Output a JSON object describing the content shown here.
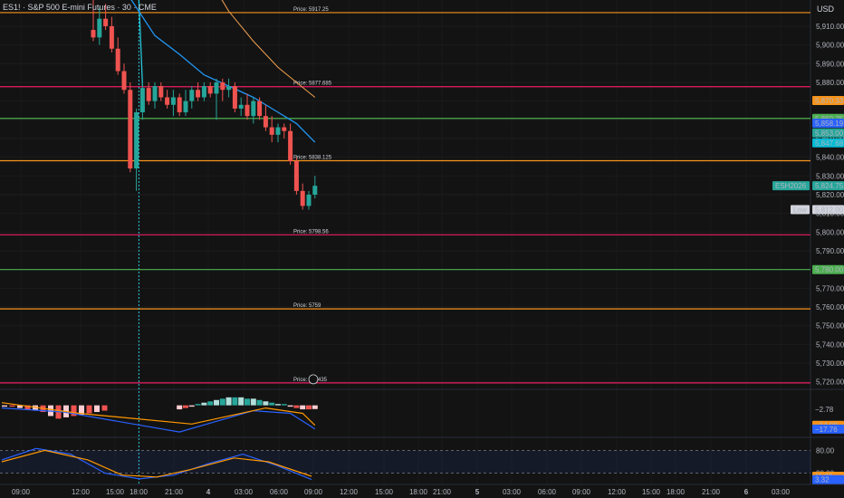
{
  "header": {
    "symbol_title": "ES1! · S&P 500 E-mini Futures · 30 · CME",
    "currency": "USD"
  },
  "colors": {
    "background": "#131313",
    "up": "#26a69a",
    "down": "#ef5350",
    "level_orange": "#f7931a",
    "level_pink": "#e91e63",
    "level_green": "#4caf50",
    "ma_blue": "#2962ff",
    "ma_orange": "#f0a050",
    "crosshair": "#26c6da"
  },
  "chart_data": [
    {
      "type": "candlestick",
      "y_ticks": [
        5910,
        5900,
        5890,
        5880,
        5870,
        5860,
        5850,
        5840,
        5830,
        5820,
        5810,
        5800,
        5790,
        5780,
        5770,
        5760,
        5750,
        5740,
        5730,
        5720
      ],
      "x_ticks": [
        "09:00",
        "12:00",
        "15:00",
        "18:00",
        "21:00",
        "4",
        "03:00",
        "06:00",
        "09:00",
        "12:00",
        "15:00",
        "18:00",
        "21:00",
        "5",
        "03:00",
        "06:00",
        "09:00",
        "12:00",
        "15:00",
        "18:00",
        "21:00",
        "6",
        "03:00"
      ],
      "ylim": [
        5716,
        5924
      ],
      "candles": [
        {
          "o": 5908,
          "h": 5924,
          "l": 5902,
          "c": 5904
        },
        {
          "o": 5904,
          "h": 5920,
          "l": 5900,
          "c": 5914
        },
        {
          "o": 5914,
          "h": 5922,
          "l": 5908,
          "c": 5910
        },
        {
          "o": 5910,
          "h": 5915,
          "l": 5896,
          "c": 5898
        },
        {
          "o": 5898,
          "h": 5904,
          "l": 5884,
          "c": 5886
        },
        {
          "o": 5886,
          "h": 5890,
          "l": 5874,
          "c": 5876
        },
        {
          "o": 5876,
          "h": 5880,
          "l": 5832,
          "c": 5834
        },
        {
          "o": 5834,
          "h": 5866,
          "l": 5822,
          "c": 5864
        },
        {
          "o": 5864,
          "h": 5880,
          "l": 5860,
          "c": 5877
        },
        {
          "o": 5877,
          "h": 5880,
          "l": 5868,
          "c": 5870
        },
        {
          "o": 5870,
          "h": 5880,
          "l": 5866,
          "c": 5878
        },
        {
          "o": 5878,
          "h": 5880,
          "l": 5870,
          "c": 5872
        },
        {
          "o": 5872,
          "h": 5876,
          "l": 5866,
          "c": 5868
        },
        {
          "o": 5868,
          "h": 5876,
          "l": 5862,
          "c": 5872
        },
        {
          "o": 5872,
          "h": 5874,
          "l": 5862,
          "c": 5864
        },
        {
          "o": 5864,
          "h": 5876,
          "l": 5862,
          "c": 5870
        },
        {
          "o": 5870,
          "h": 5878,
          "l": 5866,
          "c": 5876
        },
        {
          "o": 5876,
          "h": 5880,
          "l": 5870,
          "c": 5872
        },
        {
          "o": 5872,
          "h": 5880,
          "l": 5870,
          "c": 5878
        },
        {
          "o": 5878,
          "h": 5880,
          "l": 5872,
          "c": 5874
        },
        {
          "o": 5874,
          "h": 5882,
          "l": 5860,
          "c": 5880
        },
        {
          "o": 5880,
          "h": 5882,
          "l": 5870,
          "c": 5876
        },
        {
          "o": 5876,
          "h": 5882,
          "l": 5872,
          "c": 5878
        },
        {
          "o": 5878,
          "h": 5880,
          "l": 5864,
          "c": 5866
        },
        {
          "o": 5866,
          "h": 5872,
          "l": 5862,
          "c": 5868
        },
        {
          "o": 5868,
          "h": 5874,
          "l": 5860,
          "c": 5862
        },
        {
          "o": 5862,
          "h": 5872,
          "l": 5858,
          "c": 5870
        },
        {
          "o": 5870,
          "h": 5872,
          "l": 5860,
          "c": 5862
        },
        {
          "o": 5862,
          "h": 5868,
          "l": 5854,
          "c": 5856
        },
        {
          "o": 5856,
          "h": 5862,
          "l": 5848,
          "c": 5852
        },
        {
          "o": 5852,
          "h": 5858,
          "l": 5848,
          "c": 5856
        },
        {
          "o": 5856,
          "h": 5858,
          "l": 5850,
          "c": 5854
        },
        {
          "o": 5854,
          "h": 5858,
          "l": 5836,
          "c": 5838
        },
        {
          "o": 5838,
          "h": 5840,
          "l": 5820,
          "c": 5822
        },
        {
          "o": 5822,
          "h": 5826,
          "l": 5812,
          "c": 5814
        },
        {
          "o": 5814,
          "h": 5822,
          "l": 5812,
          "c": 5820
        },
        {
          "o": 5820,
          "h": 5830,
          "l": 5818,
          "c": 5824.75
        }
      ],
      "ma_fast": [
        [
          0,
          5940
        ],
        [
          5,
          5930
        ],
        [
          10,
          5905
        ],
        [
          14,
          5895
        ],
        [
          18,
          5884
        ],
        [
          22,
          5878
        ],
        [
          26,
          5872
        ],
        [
          30,
          5864
        ],
        [
          33,
          5858
        ],
        [
          36,
          5848
        ]
      ],
      "ma_slow": [
        [
          18,
          5940
        ],
        [
          22,
          5918
        ],
        [
          26,
          5902
        ],
        [
          30,
          5888
        ],
        [
          33,
          5880
        ],
        [
          36,
          5872
        ]
      ],
      "crosshair_index": 8,
      "levels": [
        {
          "price": 5917.25,
          "label": "Price: 5917.25",
          "color": "#f7931a"
        },
        {
          "price": 5877.685,
          "label": "Price: 5877.685",
          "color": "#e91e63"
        },
        {
          "price": 5860.75,
          "label": "",
          "color": "#4caf50"
        },
        {
          "price": 5838.125,
          "label": "Price: 5838.125",
          "color": "#f7931a"
        },
        {
          "price": 5798.56,
          "label": "Price: 5798.56",
          "color": "#e91e63"
        },
        {
          "price": 5780.0,
          "label": "",
          "color": "#4caf50"
        },
        {
          "price": 5759,
          "label": "Price: 5759",
          "color": "#f7931a"
        },
        {
          "price": 5719.435,
          "label": "Price: 57   .435",
          "color": "#e91e63"
        }
      ],
      "price_tags": [
        {
          "price": 5870.33,
          "text": "5,870.33",
          "bg": "#f7931a",
          "fg": "#131313"
        },
        {
          "price": 5860.75,
          "text": "5,860.75",
          "bg": "#4caf50",
          "fg": "#131313"
        },
        {
          "price": 5858.19,
          "text": "5,858.19",
          "bg": "#2962ff",
          "fg": "#ffffff"
        },
        {
          "price": 5853.0,
          "text": "5,853.00",
          "bg": "#26a69a",
          "fg": "#131313"
        },
        {
          "price": 5847.68,
          "text": "5,847.68",
          "bg": "#00bcd4",
          "fg": "#131313"
        },
        {
          "price": 5824.75,
          "text": "5,824.75",
          "bg": "#26a69a",
          "fg": "#ffffff"
        },
        {
          "price": 5812.0,
          "text": "5,812.00",
          "bg": "#d1d4dc",
          "fg": "#131313"
        },
        {
          "price": 5780.0,
          "text": "5,780.00",
          "bg": "#4caf50",
          "fg": "#131313"
        }
      ],
      "side_labels": [
        {
          "price": 5824.75,
          "text": "ESH2026",
          "bg": "#26a69a",
          "fg": "#ffffff"
        },
        {
          "price": 5812.0,
          "text": "Low",
          "bg": "#d1d4dc",
          "fg": "#131313"
        }
      ]
    },
    {
      "type": "bar",
      "panel": "macd",
      "histogram": [
        -1,
        -1,
        -2,
        -3,
        -4,
        -5,
        -8,
        -10,
        -9,
        -8,
        -7,
        -6,
        -5,
        -4,
        -3,
        -2,
        -1,
        1,
        2,
        3,
        4,
        5,
        6,
        6,
        6,
        5,
        5,
        4,
        3,
        2,
        1,
        1,
        -1,
        -2,
        -3,
        -3,
        -2.78
      ],
      "macd_line": [
        [
          0,
          -2
        ],
        [
          8,
          -5
        ],
        [
          14,
          -20
        ],
        [
          20,
          -12
        ],
        [
          26,
          -4
        ],
        [
          32,
          -6
        ],
        [
          36,
          -17.76
        ]
      ],
      "signal_line": [
        [
          0,
          2
        ],
        [
          10,
          -6
        ],
        [
          16,
          -14
        ],
        [
          22,
          -8
        ],
        [
          28,
          -2
        ],
        [
          34,
          -6
        ],
        [
          36,
          -14.98
        ]
      ],
      "tags": [
        {
          "value": -2.78,
          "text": "−2.78",
          "bg": "#131313",
          "fg": "#d1d4dc"
        },
        {
          "value": -14.98,
          "text": "−14.98",
          "bg": "#f7931a",
          "fg": "#131313"
        },
        {
          "value": -17.76,
          "text": "−17.76",
          "bg": "#2962ff",
          "fg": "#ffffff"
        }
      ],
      "ylim": [
        -24,
        12
      ]
    },
    {
      "type": "line",
      "panel": "stochastic",
      "k_line": [
        [
          0,
          55
        ],
        [
          4,
          85
        ],
        [
          8,
          70
        ],
        [
          12,
          20
        ],
        [
          16,
          5
        ],
        [
          20,
          15
        ],
        [
          24,
          45
        ],
        [
          28,
          70
        ],
        [
          32,
          40
        ],
        [
          36,
          3.32
        ]
      ],
      "d_line": [
        [
          0,
          50
        ],
        [
          5,
          80
        ],
        [
          10,
          55
        ],
        [
          14,
          15
        ],
        [
          18,
          10
        ],
        [
          22,
          30
        ],
        [
          27,
          60
        ],
        [
          31,
          50
        ],
        [
          36,
          11.83
        ]
      ],
      "upper": 80,
      "lower": 20,
      "tick": "80.00",
      "lower_tick": "20.00",
      "tags": [
        {
          "value": 11.83,
          "text": "11.83",
          "bg": "#f7931a",
          "fg": "#131313"
        },
        {
          "value": 3.32,
          "text": "3.32",
          "bg": "#2962ff",
          "fg": "#ffffff"
        }
      ],
      "ylim": [
        0,
        100
      ]
    }
  ]
}
